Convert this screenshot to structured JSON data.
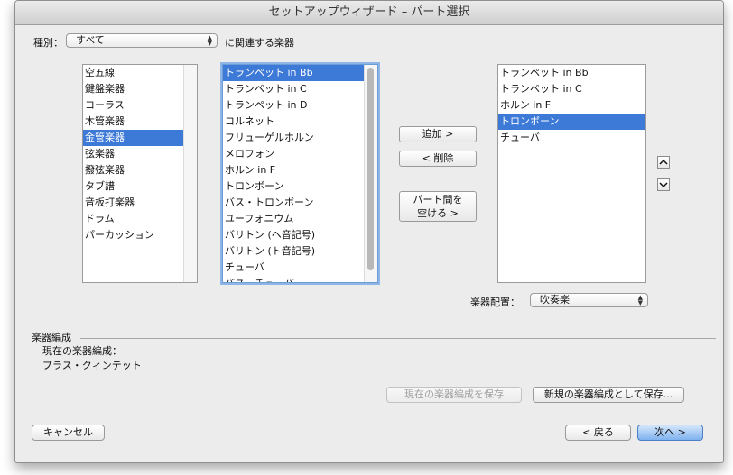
{
  "window": {
    "title": "セットアップウィザード – パート選択"
  },
  "filter": {
    "label": "種別：",
    "value": "すべて",
    "suffix": "に関連する楽器"
  },
  "categories": {
    "items": [
      "空五線",
      "鍵盤楽器",
      "コーラス",
      "木管楽器",
      "金管楽器",
      "弦楽器",
      "撥弦楽器",
      "タブ譜",
      "音板打楽器",
      "ドラム",
      "パーカッション"
    ],
    "selected": 4
  },
  "instruments": {
    "items": [
      "トランペット in Bb",
      "トランペット in C",
      "トランペット in D",
      "コルネット",
      "フリューゲルホルン",
      "メロフォン",
      "ホルン in F",
      "トロンボーン",
      "バス・トロンボーン",
      "ユーフォニウム",
      "バリトン (ヘ音記号)",
      "バリトン (ト音記号)",
      "チューバ",
      "バス・チューバ"
    ],
    "selected": 0,
    "scroll_fraction": 0.0
  },
  "buttons": {
    "add": "追加 >",
    "remove": "< 削除",
    "space_line1": "パート間を",
    "space_line2": "空ける >",
    "save_current": "現在の楽器編成を保存",
    "save_new": "新規の楽器編成として保存...",
    "cancel": "キャンセル",
    "back": "< 戻る",
    "next": "次へ >"
  },
  "score_parts": {
    "items": [
      "トランペット in Bb",
      "トランペット in C",
      "ホルン in F",
      "トロンボーン",
      "チューバ"
    ],
    "selected": 3
  },
  "order": {
    "label": "楽器配置：",
    "value": "吹奏楽"
  },
  "ensemble": {
    "section_label": "楽器編成",
    "current_label": "現在の楽器編成：",
    "current_value": "ブラス・クィンテット"
  },
  "icons": {
    "move_up": "chevron-up-icon",
    "move_down": "chevron-down-icon",
    "popup": "updown-arrows-icon"
  }
}
